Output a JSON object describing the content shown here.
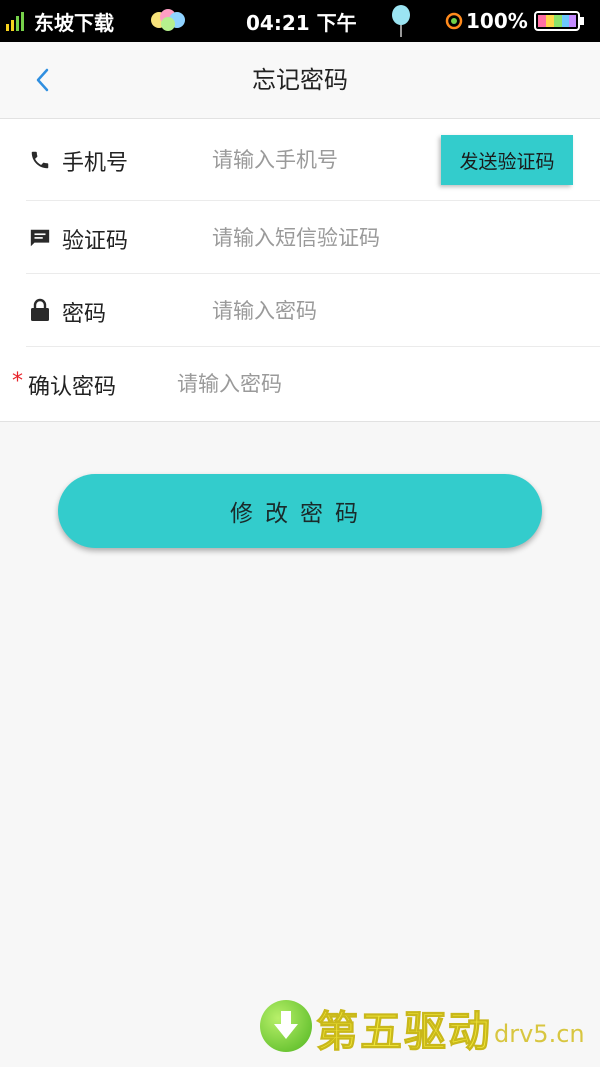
{
  "status_bar": {
    "carrier": "东坡下载",
    "time": "04:21 下午",
    "battery": "100%"
  },
  "nav": {
    "title": "忘记密码"
  },
  "form": {
    "phone": {
      "label": "手机号",
      "placeholder": "请输入手机号",
      "send_code_label": "发送验证码"
    },
    "code": {
      "label": "验证码",
      "placeholder": "请输入短信验证码"
    },
    "password": {
      "label": "密码",
      "placeholder": "请输入密码"
    },
    "confirm": {
      "required": "*",
      "label": "确认密码",
      "placeholder": "请输入密码"
    }
  },
  "submit_label": "修改密码",
  "watermark": {
    "text": "第五驱动",
    "domain": "drv5.cn"
  },
  "colors": {
    "accent": "#33cccc",
    "required": "#e8232a",
    "back_arrow": "#2f8fe0"
  },
  "icons": [
    "signal-icon",
    "balloons-icon",
    "balloon-icon",
    "location-icon",
    "battery-icon",
    "back-arrow-icon",
    "phone-icon",
    "message-icon",
    "lock-icon",
    "download-icon"
  ]
}
